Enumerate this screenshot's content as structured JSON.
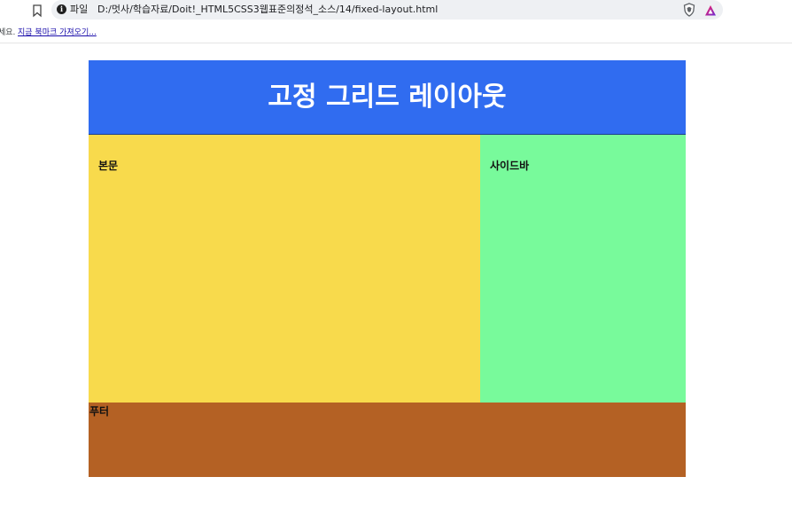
{
  "browser": {
    "address_bar": {
      "scheme_label": "파일",
      "url": "D:/멋사/학습자료/Doit!_HTML5CSS3웹표준의정석_소스/14/fixed-layout.html"
    },
    "bookmarks_bar": {
      "prompt": "세요.",
      "import_link": "지금 북마크 가져오기..."
    },
    "icons": {
      "bookmark": "bookmark-icon",
      "info": "info-icon",
      "shield": "brave-shield-icon",
      "rewards": "brave-rewards-icon"
    }
  },
  "page": {
    "header": {
      "title": "고정 그리드 레이아웃",
      "color": "#306cf0"
    },
    "main": {
      "label": "본문",
      "color": "#f8da4c"
    },
    "sidebar": {
      "label": "사이드바",
      "color": "#78fa9b"
    },
    "footer": {
      "label": "푸터",
      "color": "#b46124"
    }
  }
}
